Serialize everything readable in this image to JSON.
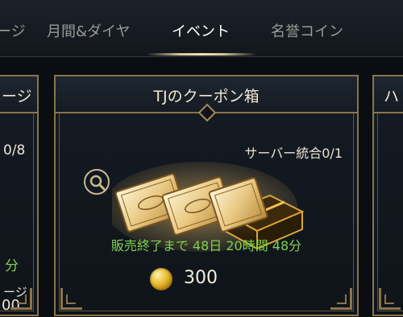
{
  "tabs": [
    {
      "label": "ージ"
    },
    {
      "label": "月間&ダイヤ"
    },
    {
      "label": "イベント",
      "active": true
    },
    {
      "label": "名誉コイン"
    }
  ],
  "left_card": {
    "title": "ージ",
    "limit": "0/8",
    "timer_fragment": "分",
    "label_fragment": "ージ",
    "price_fragment": "00"
  },
  "main_card": {
    "title": "TJのクーポン箱",
    "limit": "サーバー統合0/1",
    "item_icon": "coupon-tickets-and-gold-box",
    "timer": "販売終了まで 48日 20時間 48分",
    "currency_icon": "gold-coin",
    "price": "300"
  },
  "right_card": {
    "title": "ハ"
  },
  "colors": {
    "frame_gold": "#8a7448",
    "timer_green": "#7fd14f",
    "background": "#0b0f14"
  }
}
